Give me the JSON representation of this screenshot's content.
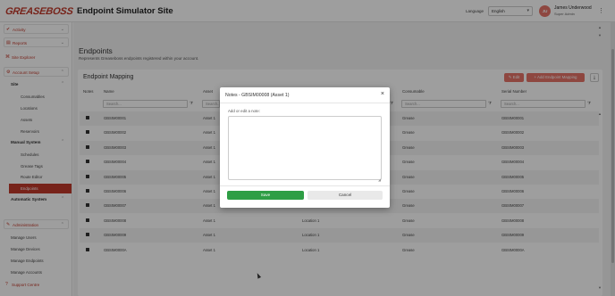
{
  "header": {
    "logo_text": "GREASEBOSS",
    "app_title": "Endpoint Simulator Site",
    "language_label": "Language",
    "language_value": "English",
    "user_initials": "JU",
    "user_name": "James Underwood",
    "user_role": "Super Admin"
  },
  "sidebar": {
    "activity": "Activity",
    "reports": "Reports",
    "site_explorer": "Site Explorer",
    "account_setup": "Account Setup",
    "site_heading": "Site",
    "site_items": [
      "Consumables",
      "Locations",
      "Assets",
      "Reservoirs"
    ],
    "manual_heading": "Manual System",
    "manual_items": [
      "Schedules",
      "Grease Tags",
      "Route Editor",
      "Devices"
    ],
    "automatic_heading": "Automatic System",
    "automatic_active": "Endpoints",
    "administration": "Administration",
    "admin_items": [
      "Manage Users",
      "Manage Devices",
      "Manage Endpoints",
      "Manage Accounts"
    ],
    "support_centre": "Support Centre"
  },
  "page": {
    "title": "Endpoints",
    "subtitle": "Represents Greaseboss endpoints registered within your account.",
    "card_title": "Endpoint Mapping",
    "edit_label": "Edit",
    "add_label": "Add Endpoint Mapping"
  },
  "table": {
    "headers": [
      "Notes",
      "Name",
      "Asset",
      "Consumable",
      "Serial Number"
    ],
    "search_placeholder": "Search...",
    "rows": [
      {
        "name": "GBSIM00001",
        "asset": "Asset 1",
        "location": "",
        "consumable": "Grease",
        "serial": "GBSIM00001"
      },
      {
        "name": "GBSIM00002",
        "asset": "Asset 1",
        "location": "",
        "consumable": "Grease",
        "serial": "GBSIM00002"
      },
      {
        "name": "GBSIM00003",
        "asset": "Asset 1",
        "location": "",
        "consumable": "Grease",
        "serial": "GBSIM00003"
      },
      {
        "name": "GBSIM00004",
        "asset": "Asset 1",
        "location": "",
        "consumable": "Grease",
        "serial": "GBSIM00004"
      },
      {
        "name": "GBSIM00005",
        "asset": "Asset 1",
        "location": "",
        "consumable": "Grease",
        "serial": "GBSIM00005"
      },
      {
        "name": "GBSIM00006",
        "asset": "Asset 1",
        "location": "",
        "consumable": "Grease",
        "serial": "GBSIM00006"
      },
      {
        "name": "GBSIM00007",
        "asset": "Asset 1",
        "location": "",
        "consumable": "Grease",
        "serial": "GBSIM00007"
      },
      {
        "name": "GBSIM00008",
        "asset": "Asset 1",
        "location": "Location 1",
        "consumable": "Grease",
        "serial": "GBSIM00008"
      },
      {
        "name": "GBSIM00009",
        "asset": "Asset 1",
        "location": "Location 1",
        "consumable": "Grease",
        "serial": "GBSIM00009"
      },
      {
        "name": "GBSIM0000A",
        "asset": "Asset 1",
        "location": "Location 1",
        "consumable": "Grease",
        "serial": "GBSIM0000A"
      }
    ]
  },
  "modal": {
    "title": "Notes - GBSIM00008 (Asset 1)",
    "close": "×",
    "label": "Add or edit a note:",
    "note_value": "",
    "save_label": "Save",
    "cancel_label": "Cancel"
  },
  "colors": {
    "brand": "#c0392b",
    "accent": "#e57368",
    "save": "#2e9e45"
  }
}
